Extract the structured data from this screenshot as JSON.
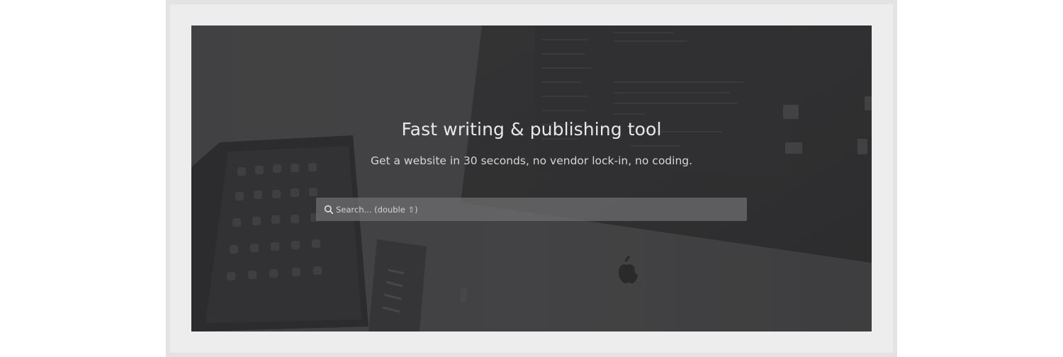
{
  "hero": {
    "title": "Fast writing & publishing tool",
    "subtitle": "Get a website in 30 seconds, no vendor lock-in, no coding.",
    "background_image": "desk-with-tablet-and-imac-photo"
  },
  "search": {
    "placeholder": "Search... (double ⇧)",
    "value": "",
    "icon": "search-icon"
  },
  "colors": {
    "page_frame": "#e3e3e3",
    "page_inner": "#ededed",
    "hero_overlay": "#3e3e40",
    "text": "#e8e8e8"
  }
}
